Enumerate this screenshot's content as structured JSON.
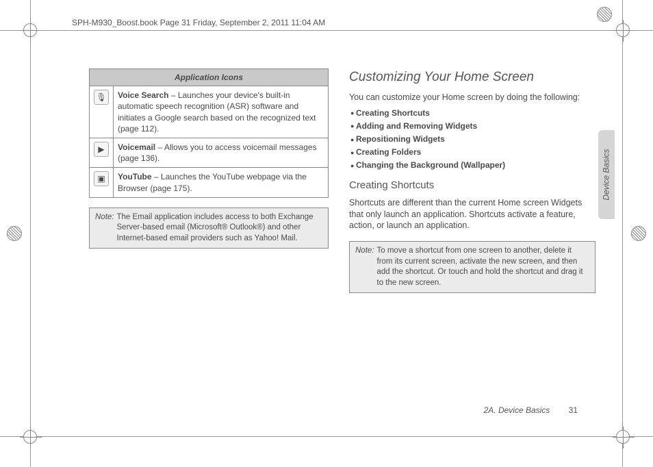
{
  "header": "SPH-M930_Boost.book  Page 31  Friday, September 2, 2011  11:04 AM",
  "table": {
    "title": "Application Icons",
    "rows": [
      {
        "icon": "🎙",
        "name": "Voice Search",
        "desc": " – Launches your device's built-in automatic speech recognition (ASR) software and initiates a Google search based on the recognized text (page 112)."
      },
      {
        "icon": "▶",
        "name": "Voicemail",
        "desc": " – Allows you to access voicemail messages (page 136)."
      },
      {
        "icon": "▣",
        "name": "YouTube",
        "desc": " – Launches the YouTube webpage via the Browser (page 175)."
      }
    ]
  },
  "note_left": {
    "label": "Note:",
    "text": "The Email application includes access to both Exchange Server-based email (Microsoft® Outlook®) and other Internet-based email providers such as Yahoo! Mail."
  },
  "right": {
    "h2": "Customizing Your Home Screen",
    "intro": "You can customize your Home screen by doing the following:",
    "bullets": [
      "Creating Shortcuts",
      "Adding and Removing Widgets",
      "Repositioning Widgets",
      "Creating Folders",
      "Changing the Background (Wallpaper)"
    ],
    "h3": "Creating Shortcuts",
    "p2": "Shortcuts are different than the current Home screen Widgets that only launch an application. Shortcuts activate a feature, action, or launch an application.",
    "note": {
      "label": "Note:",
      "text": "To move a shortcut from one screen to another, delete it from its current screen, activate the new screen, and then add the shortcut. Or touch and hold the shortcut and drag it to the new screen."
    }
  },
  "side_tab": "Device Basics",
  "footer": {
    "section": "2A. Device Basics",
    "page": "31"
  }
}
